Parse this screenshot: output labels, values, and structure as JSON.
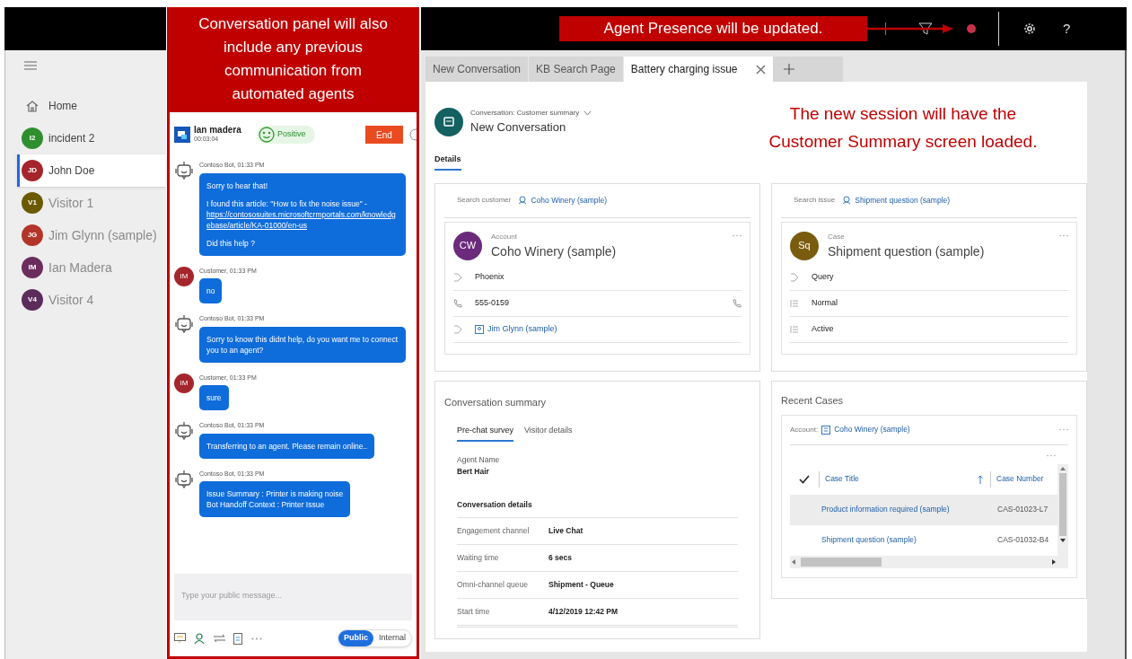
{
  "callouts": {
    "panel": "Conversation panel will also include any previous communication from automated agents",
    "presence": "Agent Presence will be updated.",
    "session": "The new session will have the Customer Summary screen loaded."
  },
  "top_bar": {
    "help": "?"
  },
  "sidebar": {
    "items": [
      {
        "kind": "home",
        "label": "Home",
        "selected": false,
        "dimmed": false
      },
      {
        "kind": "session",
        "label": "incident 2",
        "initials": "I2",
        "color": "#2f8f2f",
        "selected": false,
        "dimmed": false
      },
      {
        "kind": "session",
        "label": "John Doe",
        "initials": "JD",
        "color": "#a4262c",
        "selected": true,
        "dimmed": false
      },
      {
        "kind": "session",
        "label": "Visitor 1",
        "initials": "V1",
        "color": "#6b5a00",
        "selected": false,
        "dimmed": true
      },
      {
        "kind": "session",
        "label": "Jim Glynn (sample)",
        "initials": "JG",
        "color": "#b3352a",
        "selected": false,
        "dimmed": true
      },
      {
        "kind": "session",
        "label": "Ian Madera",
        "initials": "IM",
        "color": "#6b2d5e",
        "selected": false,
        "dimmed": true
      },
      {
        "kind": "session",
        "label": "Visitor 4",
        "initials": "V4",
        "color": "#5c2d5c",
        "selected": false,
        "dimmed": true
      }
    ]
  },
  "conversation": {
    "customer": "Ian madera",
    "timer": "00:03:04",
    "sentiment": "Positive",
    "end_button": "End",
    "messages": [
      {
        "kind": "bot",
        "meta": "Contoso Bot, 01:33 PM",
        "paragraphs": [
          {
            "text": "Sorry to hear that!"
          },
          {
            "text": "I found this article: \"How to fix the noise issue\" -",
            "link": "https://contososuites.microsoftcrmportals.com/knowledgebase/article/KA-01000/en-us"
          },
          {
            "text": "Did this help ?"
          }
        ]
      },
      {
        "kind": "customer",
        "meta": "Customer, 01:33 PM",
        "initials": "IM",
        "paragraphs": [
          {
            "text": "no"
          }
        ]
      },
      {
        "kind": "bot",
        "meta": "Contoso Bot, 01:33 PM",
        "paragraphs": [
          {
            "text": "Sorry to know this didnt help, do you want me to connect you to an agent?"
          }
        ]
      },
      {
        "kind": "customer",
        "meta": "Customer, 01:33 PM",
        "initials": "IM",
        "paragraphs": [
          {
            "text": "sure"
          }
        ]
      },
      {
        "kind": "bot",
        "meta": "Contoso Bot, 01:33 PM",
        "paragraphs": [
          {
            "text": "Transferring to an agent. Please remain online.."
          }
        ]
      },
      {
        "kind": "bot",
        "meta": "Contoso Bot, 01:33 PM",
        "paragraphs": [
          {
            "lines": [
              "Issue Summary : Printer is making noise",
              "Bot Handoff Context : Printer Issue"
            ]
          }
        ]
      }
    ],
    "input_placeholder": "Type your public message...",
    "modes": [
      {
        "label": "Public",
        "selected": true
      },
      {
        "label": "Internal",
        "selected": false
      }
    ]
  },
  "tabs": [
    {
      "label": "New Conversation",
      "selected": false
    },
    {
      "label": "KB Search Page",
      "selected": false
    },
    {
      "label": "Battery charging issue",
      "selected": true
    }
  ],
  "header": {
    "form_name": "Conversation: Customer summary",
    "title": "New Conversation",
    "section_tabs": [
      {
        "label": "Details",
        "selected": true
      }
    ]
  },
  "customer": {
    "search_label": "Search customer",
    "search_value": "Coho Winery (sample)",
    "card": {
      "type": "Account",
      "initials": "CW",
      "color": "#6b2a7c",
      "name": "Coho Winery (sample)",
      "rows": [
        {
          "kind": "text",
          "value": "Phoenix"
        },
        {
          "kind": "phone",
          "value": "555-0159"
        },
        {
          "kind": "link",
          "value": "Jim Glynn (sample)"
        }
      ]
    }
  },
  "issue": {
    "search_label": "Search issue",
    "search_value": "Shipment question (sample)",
    "card": {
      "type": "Case",
      "initials": "Sq",
      "color": "#7a5c0f",
      "name": "Shipment question (sample)",
      "rows": [
        {
          "kind": "text",
          "value": "Query"
        },
        {
          "kind": "list",
          "value": "Normal"
        },
        {
          "kind": "list",
          "value": "Active"
        }
      ]
    }
  },
  "summary": {
    "title": "Conversation summary",
    "tabs": [
      {
        "label": "Pre-chat survey",
        "selected": true
      },
      {
        "label": "Visitor details",
        "selected": false
      }
    ],
    "agent_label": "Agent Name",
    "agent_value": "Bert Hair",
    "details_heading": "Conversation details",
    "rows": [
      {
        "label": "Engagement channel",
        "value": "Live Chat"
      },
      {
        "label": "Waiting time",
        "value": "6 secs"
      },
      {
        "label": "Omni-channel queue",
        "value": "Shipment - Queue"
      },
      {
        "label": "Start time",
        "value": "4/12/2019 12:42 PM"
      }
    ]
  },
  "recent_cases": {
    "title": "Recent Cases",
    "account_label": "Account:",
    "account_value": "Coho Winery (sample)",
    "columns": [
      "Case Title",
      "Case Number"
    ],
    "rows": [
      {
        "title": "Product information required (sample)",
        "number": "CAS-01023-L7",
        "selected": true
      },
      {
        "title": "Shipment question (sample)",
        "number": "CAS-01032-B4",
        "selected": false
      }
    ]
  }
}
